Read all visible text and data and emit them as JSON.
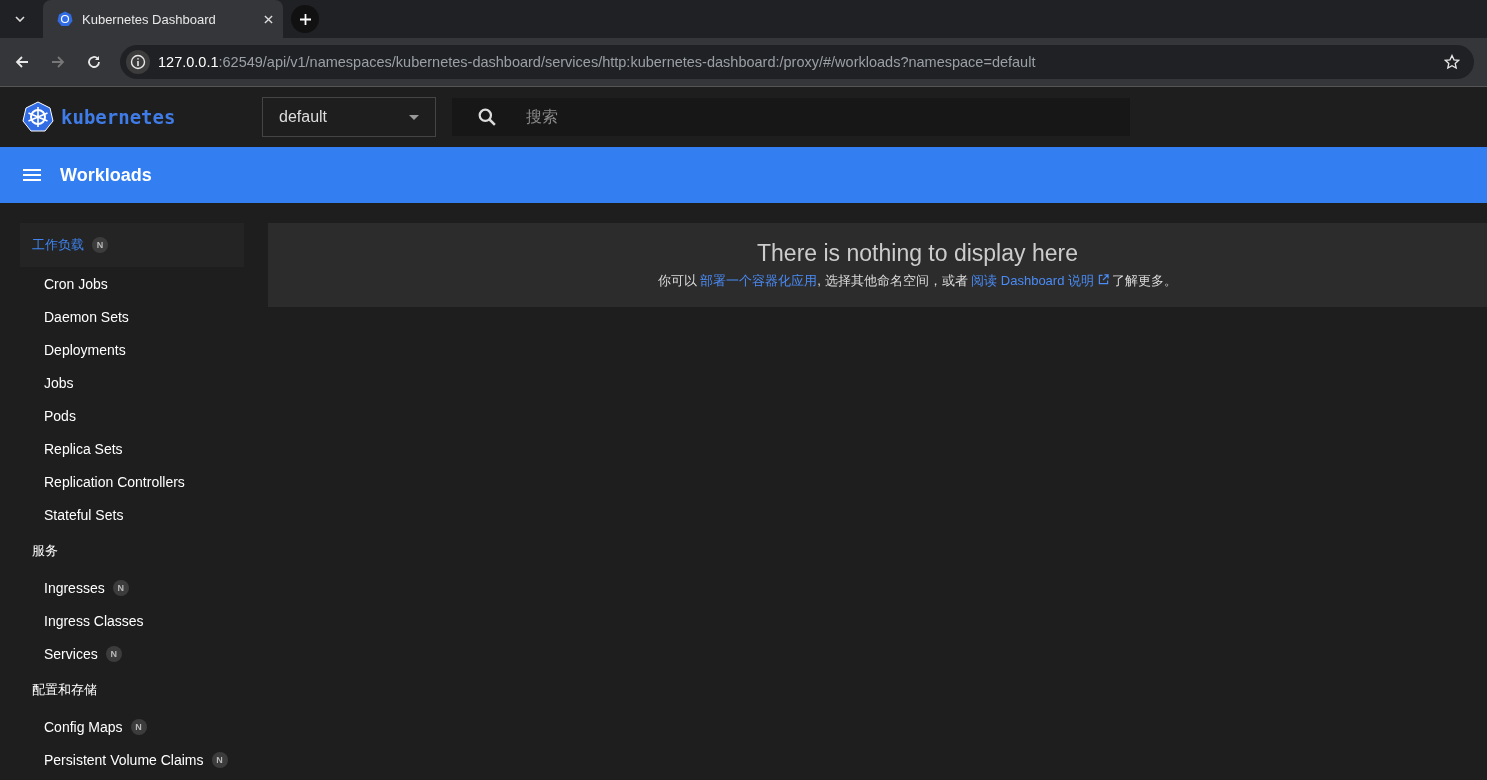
{
  "browser": {
    "tab_title": "Kubernetes Dashboard",
    "url_host": "127.0.0.1",
    "url_rest": ":62549/api/v1/namespaces/kubernetes-dashboard/services/http:kubernetes-dashboard:/proxy/#/workloads?namespace=default"
  },
  "header": {
    "logo_text": "kubernetes",
    "namespace": "default",
    "search": {
      "placeholder": "搜索"
    }
  },
  "toolbar": {
    "title": "Workloads"
  },
  "sidebar": {
    "sections": [
      {
        "label": "工作负载",
        "selected": true,
        "badge": "N",
        "items": [
          {
            "label": "Cron Jobs"
          },
          {
            "label": "Daemon Sets"
          },
          {
            "label": "Deployments"
          },
          {
            "label": "Jobs"
          },
          {
            "label": "Pods"
          },
          {
            "label": "Replica Sets"
          },
          {
            "label": "Replication Controllers"
          },
          {
            "label": "Stateful Sets"
          }
        ]
      },
      {
        "label": "服务",
        "selected": false,
        "items": [
          {
            "label": "Ingresses",
            "badge": "N"
          },
          {
            "label": "Ingress Classes"
          },
          {
            "label": "Services",
            "badge": "N"
          }
        ]
      },
      {
        "label": "配置和存储",
        "selected": false,
        "items": [
          {
            "label": "Config Maps",
            "badge": "N"
          },
          {
            "label": "Persistent Volume Claims",
            "badge": "N"
          }
        ]
      }
    ]
  },
  "empty_state": {
    "title": "There is nothing to display here",
    "message": [
      {
        "kind": "text",
        "text": "你可以 "
      },
      {
        "kind": "link",
        "text": "部署一个容器化应用"
      },
      {
        "kind": "text",
        "text": ", 选择其他命名空间，或者 "
      },
      {
        "kind": "external_link",
        "text": "阅读 Dashboard 说明"
      },
      {
        "kind": "text",
        "text": " 了解更多。"
      }
    ]
  }
}
